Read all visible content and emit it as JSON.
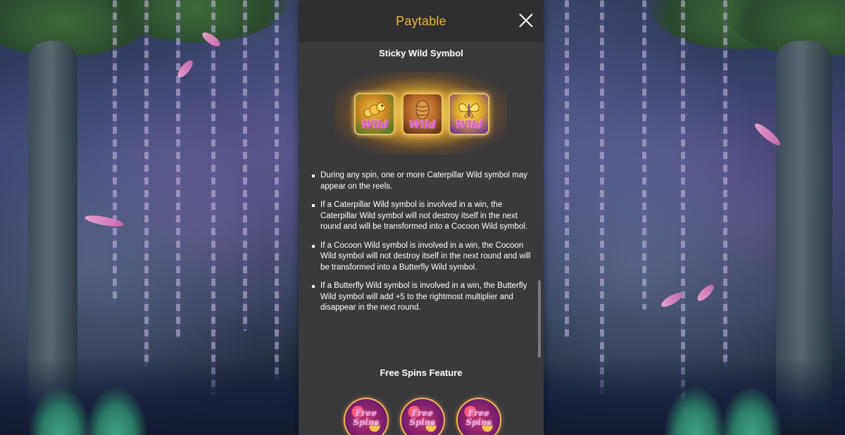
{
  "header": {
    "title": "Paytable",
    "close_icon": "close-icon"
  },
  "sticky_wild": {
    "title": "Sticky Wild Symbol",
    "symbols": [
      {
        "name": "Caterpillar Wild",
        "label": "Wild",
        "icon": "caterpillar-icon"
      },
      {
        "name": "Cocoon Wild",
        "label": "Wild",
        "icon": "cocoon-icon"
      },
      {
        "name": "Butterfly Wild",
        "label": "Wild",
        "icon": "butterfly-icon"
      }
    ],
    "rules": [
      "During any spin, one or more Caterpillar Wild symbol may appear on the reels.",
      "If a Caterpillar Wild symbol is involved in a win, the Caterpillar Wild symbol will not destroy itself in the next round and will be transformed into a Cocoon Wild symbol.",
      "If a Cocoon Wild symbol is involved in a win, the Cocoon Wild symbol will not destroy itself in the next round and will be transformed into a Butterfly Wild symbol.",
      "If a Butterfly Wild symbol is involved in a win, the Butterfly Wild symbol will add +5 to the rightmost multiplier and disappear in the next round."
    ]
  },
  "free_spins": {
    "title": "Free Spins Feature",
    "symbols": [
      {
        "label_line1": "Free",
        "label_line2": "Spins"
      },
      {
        "label_line1": "Free",
        "label_line2": "Spins"
      },
      {
        "label_line1": "Free",
        "label_line2": "Spins"
      }
    ]
  },
  "colors": {
    "title_accent": "#f4b43a",
    "panel_bg": "#3a3a3d",
    "header_bg": "#2f2f31",
    "text": "#ffffff"
  }
}
